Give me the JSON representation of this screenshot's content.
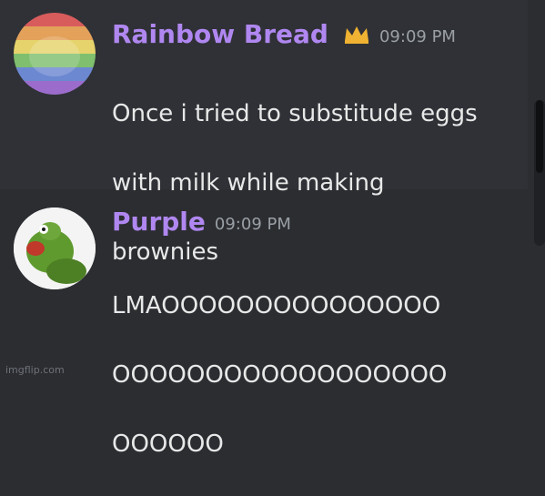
{
  "messages": [
    {
      "username": "Rainbow Bread",
      "timestamp": "09:09 PM",
      "badge_icon": "crown-icon",
      "lines": [
        "Once i tried to substitude eggs",
        "with milk while making",
        "brownies"
      ]
    },
    {
      "username": "Purple",
      "timestamp": "09:09 PM",
      "lines": [
        "LMAOOOOOOOOOOOOOOO",
        "OOOOOOOOOOOOOOOOOO",
        "OOOOOO"
      ]
    }
  ],
  "watermark": "imgflip.com",
  "colors": {
    "background": "#2b2d31",
    "username": "#b087f0",
    "text": "#e8e8e8",
    "timestamp": "#9aa0a6",
    "crown": "#f0b232"
  }
}
